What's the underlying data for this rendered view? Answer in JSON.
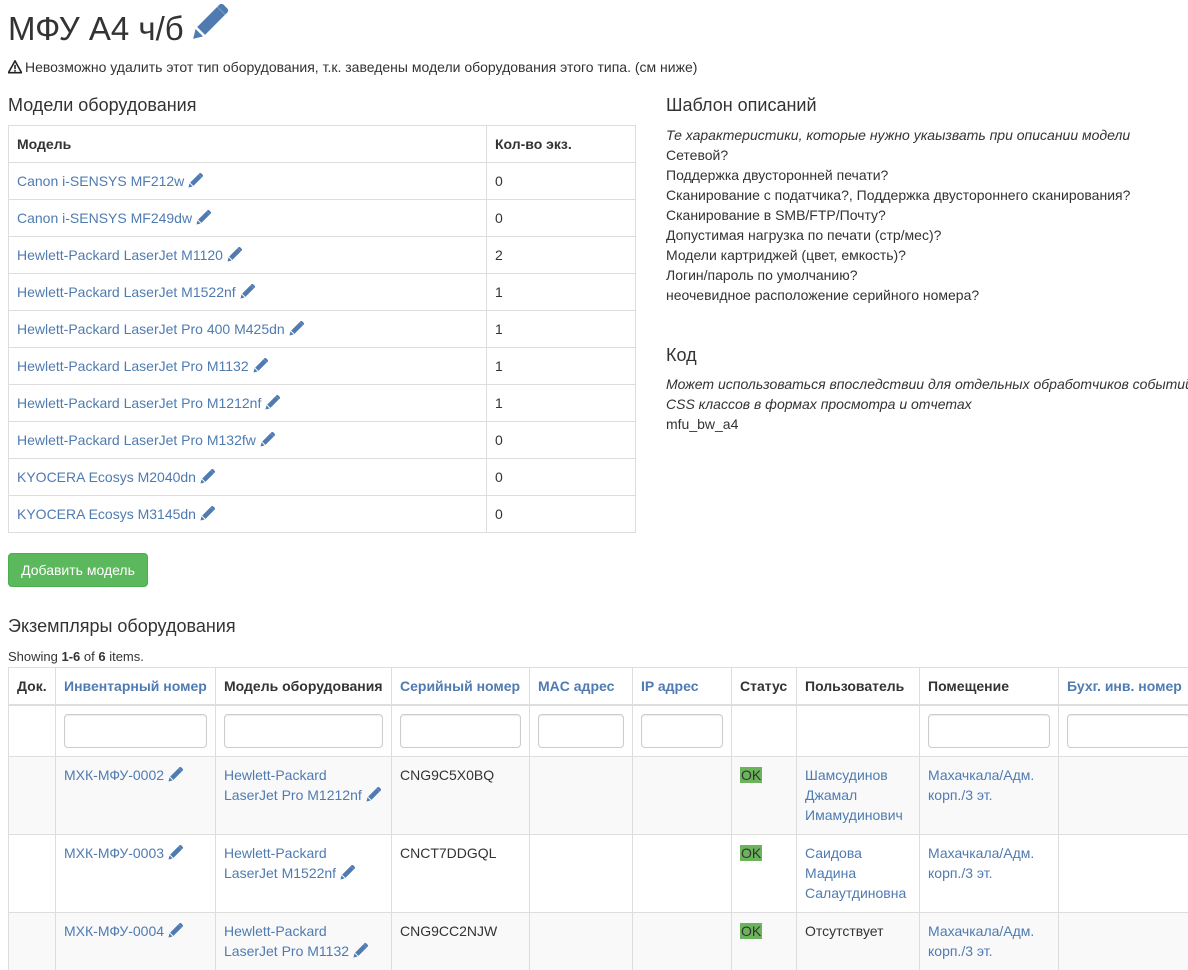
{
  "page": {
    "title": "МФУ А4 ч/б",
    "warning": "Невозможно удалить этот тип оборудования, т.к. заведены модели оборудования этого типа. (см ниже)"
  },
  "models": {
    "heading": "Модели оборудования",
    "col_model": "Модель",
    "col_count": "Кол-во экз.",
    "rows": [
      {
        "name": "Canon i-SENSYS MF212w",
        "count": "0"
      },
      {
        "name": "Canon i-SENSYS MF249dw",
        "count": "0"
      },
      {
        "name": "Hewlett-Packard LaserJet M1120",
        "count": "2"
      },
      {
        "name": "Hewlett-Packard LaserJet M1522nf",
        "count": "1"
      },
      {
        "name": "Hewlett-Packard LaserJet Pro 400 M425dn",
        "count": "1"
      },
      {
        "name": "Hewlett-Packard LaserJet Pro M1132",
        "count": "1"
      },
      {
        "name": "Hewlett-Packard LaserJet Pro M1212nf",
        "count": "1"
      },
      {
        "name": "Hewlett-Packard LaserJet Pro M132fw",
        "count": "0"
      },
      {
        "name": "KYOCERA Ecosys M2040dn",
        "count": "0"
      },
      {
        "name": "KYOCERA Ecosys M3145dn",
        "count": "0"
      }
    ],
    "add_button": "Добавить модель"
  },
  "template": {
    "heading": "Шаблон описаний",
    "hint": "Те характеристики, которые нужно укаызвать при описании модели",
    "lines": [
      "Сетевой?",
      "Поддержка двусторонней печати?",
      "Сканирование с податчика?, Поддержка двустороннего сканирования?",
      "Сканирование в SMB/FTP/Почту?",
      "Допустимая нагрузка по печати (стр/мес)?",
      "Модели картриджей (цвет, емкость)?",
      "Логин/пароль по умолчанию?",
      "неочевидное расположение серийного номера?"
    ]
  },
  "code": {
    "heading": "Код",
    "hint_line1": "Может использоваться впоследствии для отдельных обработчиков событий",
    "hint_line2": "CSS классов в формах просмотра и отчетах",
    "value": "mfu_bw_a4"
  },
  "items": {
    "heading": "Экземпляры оборудования",
    "showing_prefix": "Showing ",
    "showing_range": "1-6",
    "showing_of": " of ",
    "showing_total": "6",
    "showing_suffix": " items.",
    "columns": {
      "doc": "Док.",
      "inv": "Инвентарный номер",
      "model": "Модель оборудования",
      "serial": "Серийный номер",
      "mac": "MAC адрес",
      "ip": "IP адрес",
      "status": "Статус",
      "user": "Пользователь",
      "room": "Помещение",
      "acc": "Бухг. инв. номер"
    },
    "rows": [
      {
        "inv": "МХК-МФУ-0002",
        "model_l1": "Hewlett-Packard",
        "model_l2": "LaserJet Pro M1212nf",
        "serial": "CNG9C5X0BQ",
        "status": "OK",
        "user_l1": "Шамсудинов",
        "user_l2": "Джамал",
        "user_l3": "Имамудинович",
        "room_l1": "Махачкала/Адм.",
        "room_l2": "корп./3 эт."
      },
      {
        "inv": "МХК-МФУ-0003",
        "model_l1": "Hewlett-Packard",
        "model_l2": "LaserJet M1522nf",
        "serial": "CNCT7DDGQL",
        "status": "OK",
        "user_l1": "Саидова",
        "user_l2": "Мадина",
        "user_l3": "Салаутдиновна",
        "room_l1": "Махачкала/Адм.",
        "room_l2": "корп./3 эт."
      },
      {
        "inv": "МХК-МФУ-0004",
        "model_l1": "Hewlett-Packard",
        "model_l2": "LaserJet Pro M1132",
        "serial": "CNG9CC2NJW",
        "status": "OK",
        "user_plain": "Отсутствует",
        "room_l1": "Махачкала/Адм.",
        "room_l2": "корп./3 эт."
      }
    ]
  },
  "colors": {
    "link": "#4f7bb1",
    "success_button": "#5cb85c",
    "ok_badge": "#6bb45c",
    "border": "#dddddd"
  },
  "icons": {
    "edit": "pencil-icon",
    "warning": "warning-triangle-icon"
  }
}
